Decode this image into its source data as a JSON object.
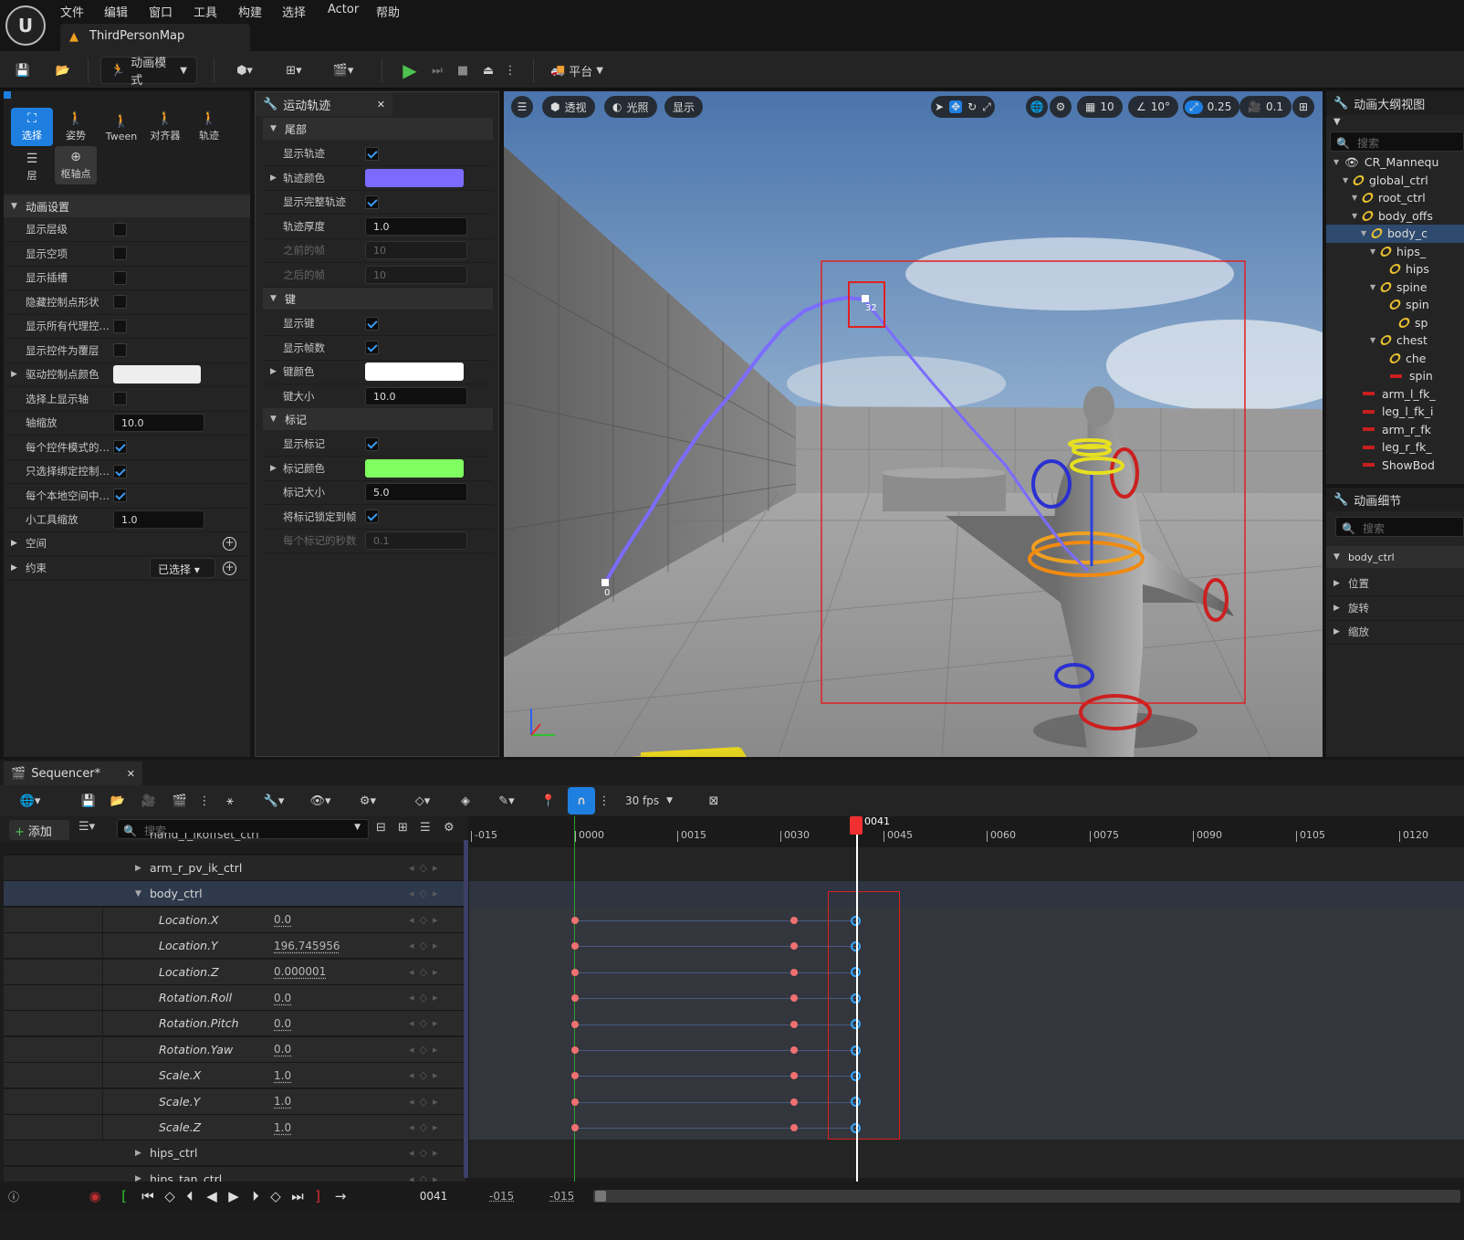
{
  "menu": {
    "items": [
      "文件",
      "编辑",
      "窗口",
      "工具",
      "构建",
      "选择",
      "Actor",
      "帮助"
    ],
    "map_tab": "ThirdPersonMap"
  },
  "toolbar": {
    "mode_label": "动画模式",
    "platform_label": "平台"
  },
  "mode_tools": {
    "select": "选择",
    "pose": "姿势",
    "tween": "Tween",
    "align": "对齐器",
    "trail": "轨迹",
    "layer": "层",
    "pivot": "枢轴点"
  },
  "anim_settings": {
    "header": "动画设置",
    "rows": [
      {
        "label": "显示层级",
        "type": "check",
        "checked": false
      },
      {
        "label": "显示空项",
        "type": "check",
        "checked": false
      },
      {
        "label": "显示插槽",
        "type": "check",
        "checked": false
      },
      {
        "label": "隐藏控制点形状",
        "type": "check",
        "checked": false
      },
      {
        "label": "显示所有代理控…",
        "type": "check",
        "checked": false
      },
      {
        "label": "显示控件为覆层",
        "type": "check",
        "checked": false
      },
      {
        "label": "驱动控制点颜色",
        "type": "color",
        "color": "#eeeeee"
      },
      {
        "label": "选择上显示轴",
        "type": "check",
        "checked": false
      },
      {
        "label": "轴缩放",
        "type": "num",
        "value": "10.0"
      },
      {
        "label": "每个控件模式的…",
        "type": "check",
        "checked": true
      },
      {
        "label": "只选择绑定控制…",
        "type": "check",
        "checked": true
      },
      {
        "label": "每个本地空间中…",
        "type": "check",
        "checked": true
      },
      {
        "label": "小工具缩放",
        "type": "num",
        "value": "1.0"
      }
    ],
    "space": "空间",
    "constraint": "约束",
    "constraint_value": "已选择"
  },
  "motion_trail": {
    "tab": "运动轨迹",
    "tail_header": "尾部",
    "tail_rows": [
      {
        "label": "显示轨迹",
        "type": "check",
        "checked": true
      },
      {
        "label": "轨迹颜色",
        "type": "color",
        "color": "#7b6cff"
      },
      {
        "label": "显示完整轨迹",
        "type": "check",
        "checked": true
      },
      {
        "label": "轨迹厚度",
        "type": "num",
        "value": "1.0"
      },
      {
        "label": "之前的帧",
        "type": "dis",
        "value": "10"
      },
      {
        "label": "之后的帧",
        "type": "dis",
        "value": "10"
      }
    ],
    "key_header": "键",
    "key_rows": [
      {
        "label": "显示键",
        "type": "check",
        "checked": true
      },
      {
        "label": "显示帧数",
        "type": "check",
        "checked": true
      },
      {
        "label": "键颜色",
        "type": "color",
        "color": "#ffffff"
      },
      {
        "label": "键大小",
        "type": "num",
        "value": "10.0"
      }
    ],
    "mark_header": "标记",
    "mark_rows": [
      {
        "label": "显示标记",
        "type": "check",
        "checked": true
      },
      {
        "label": "标记颜色",
        "type": "color",
        "color": "#80ff60"
      },
      {
        "label": "标记大小",
        "type": "num",
        "value": "5.0"
      },
      {
        "label": "将标记锁定到帧",
        "type": "check",
        "checked": true
      },
      {
        "label": "每个标记的秒数",
        "type": "dis",
        "value": "0.1"
      }
    ]
  },
  "viewport": {
    "perspective": "透视",
    "lit": "光照",
    "show": "显示",
    "grid": "10",
    "angle": "10°",
    "scale": "0.25",
    "cam": "0.1",
    "trail_start": "0",
    "trail_key": "32"
  },
  "outliner": {
    "tab": "动画大纲视图",
    "search": "搜索",
    "items": [
      {
        "label": "CR_Mannequ",
        "depth": 0,
        "kind": "eye"
      },
      {
        "label": "global_ctrl",
        "depth": 1,
        "kind": "bone"
      },
      {
        "label": "root_ctrl",
        "depth": 2,
        "kind": "bone"
      },
      {
        "label": "body_offs",
        "depth": 2,
        "kind": "bone"
      },
      {
        "label": "body_c",
        "depth": 3,
        "kind": "bone",
        "selected": true
      },
      {
        "label": "hips_",
        "depth": 4,
        "kind": "bone"
      },
      {
        "label": "hips",
        "depth": 5,
        "kind": "bone"
      },
      {
        "label": "spine",
        "depth": 4,
        "kind": "bone"
      },
      {
        "label": "spin",
        "depth": 5,
        "kind": "bone"
      },
      {
        "label": "sp",
        "depth": 6,
        "kind": "bone"
      },
      {
        "label": "chest",
        "depth": 4,
        "kind": "bone"
      },
      {
        "label": "che",
        "depth": 5,
        "kind": "bone"
      },
      {
        "label": "spin",
        "depth": 5,
        "kind": "ctl"
      },
      {
        "label": "arm_l_fk_",
        "depth": 2,
        "kind": "ctl"
      },
      {
        "label": "leg_l_fk_i",
        "depth": 2,
        "kind": "ctl"
      },
      {
        "label": "arm_r_fk",
        "depth": 2,
        "kind": "ctl"
      },
      {
        "label": "leg_r_fk_",
        "depth": 2,
        "kind": "ctl"
      },
      {
        "label": "ShowBod",
        "depth": 2,
        "kind": "ctl"
      }
    ]
  },
  "details": {
    "tab": "动画细节",
    "search": "搜索",
    "object": "body_ctrl",
    "sections": [
      "位置",
      "旋转",
      "缩放"
    ]
  },
  "sequencer": {
    "tab": "Sequencer*",
    "fps": "30 fps",
    "add": "添加",
    "search": "搜索",
    "current_frame": "0041",
    "start": "-015",
    "end": "-015",
    "ticks": [
      "-015",
      "0000",
      "0015",
      "0030",
      "0045",
      "0060",
      "0075",
      "0090",
      "0105",
      "0120"
    ],
    "tracks_partial_top": "hand_l_ikoffset_ctrl",
    "tracks": [
      {
        "label": "arm_r_pv_ik_ctrl",
        "type": "control"
      },
      {
        "label": "body_ctrl",
        "type": "control",
        "expanded": true,
        "selected": true
      },
      {
        "label": "Location.X",
        "value": "0.0",
        "type": "channel"
      },
      {
        "label": "Location.Y",
        "value": "196.745956",
        "type": "channel"
      },
      {
        "label": "Location.Z",
        "value": "0.000001",
        "type": "channel"
      },
      {
        "label": "Rotation.Roll",
        "value": "0.0",
        "type": "channel"
      },
      {
        "label": "Rotation.Pitch",
        "value": "0.0",
        "type": "channel"
      },
      {
        "label": "Rotation.Yaw",
        "value": "0.0",
        "type": "channel"
      },
      {
        "label": "Scale.X",
        "value": "1.0",
        "type": "channel"
      },
      {
        "label": "Scale.Y",
        "value": "1.0",
        "type": "channel"
      },
      {
        "label": "Scale.Z",
        "value": "1.0",
        "type": "channel"
      },
      {
        "label": "hips_ctrl",
        "type": "control"
      },
      {
        "label": "hips_tan_ctrl",
        "type": "control"
      }
    ],
    "key_frames": [
      0,
      32,
      41
    ]
  },
  "colors": {
    "accent": "#1e7fe0",
    "trail": "#7b6cff",
    "key": "#f07070",
    "selected_key": "#33a6ff",
    "marker": "#80ff60"
  }
}
